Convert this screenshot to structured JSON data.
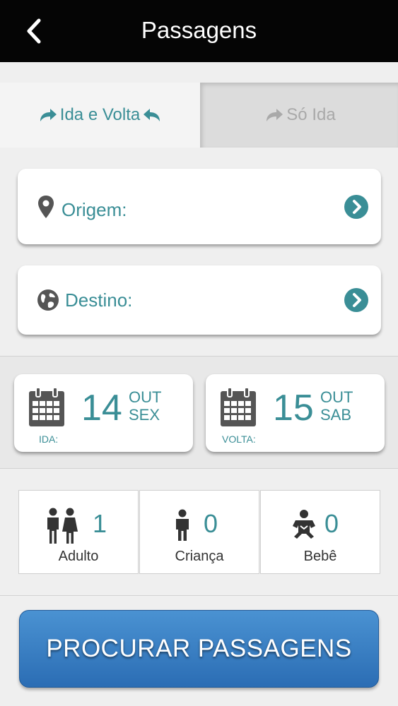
{
  "header": {
    "title": "Passagens",
    "back_icon": "chevron-left-icon"
  },
  "tabs": [
    {
      "label": "Ida e Volta",
      "selected": true
    },
    {
      "label": "Só Ida",
      "selected": false
    }
  ],
  "origin": {
    "label": "Origem:"
  },
  "destination": {
    "label": "Destino:"
  },
  "dates": {
    "departure": {
      "day": "14",
      "month": "OUT",
      "weekday": "SEX",
      "caption": "IDA:"
    },
    "return": {
      "day": "15",
      "month": "OUT",
      "weekday": "SAB",
      "caption": "VOLTA:"
    }
  },
  "passengers": [
    {
      "label": "Adulto",
      "count": "1",
      "icon": "adults-icon"
    },
    {
      "label": "Criança",
      "count": "0",
      "icon": "child-icon"
    },
    {
      "label": "Bebê",
      "count": "0",
      "icon": "baby-icon"
    }
  ],
  "search_button": {
    "label": "PROCURAR PASSAGENS"
  },
  "colors": {
    "accent": "#3a8e96",
    "header_bg": "#050505",
    "button_blue": "#2f74bd"
  }
}
